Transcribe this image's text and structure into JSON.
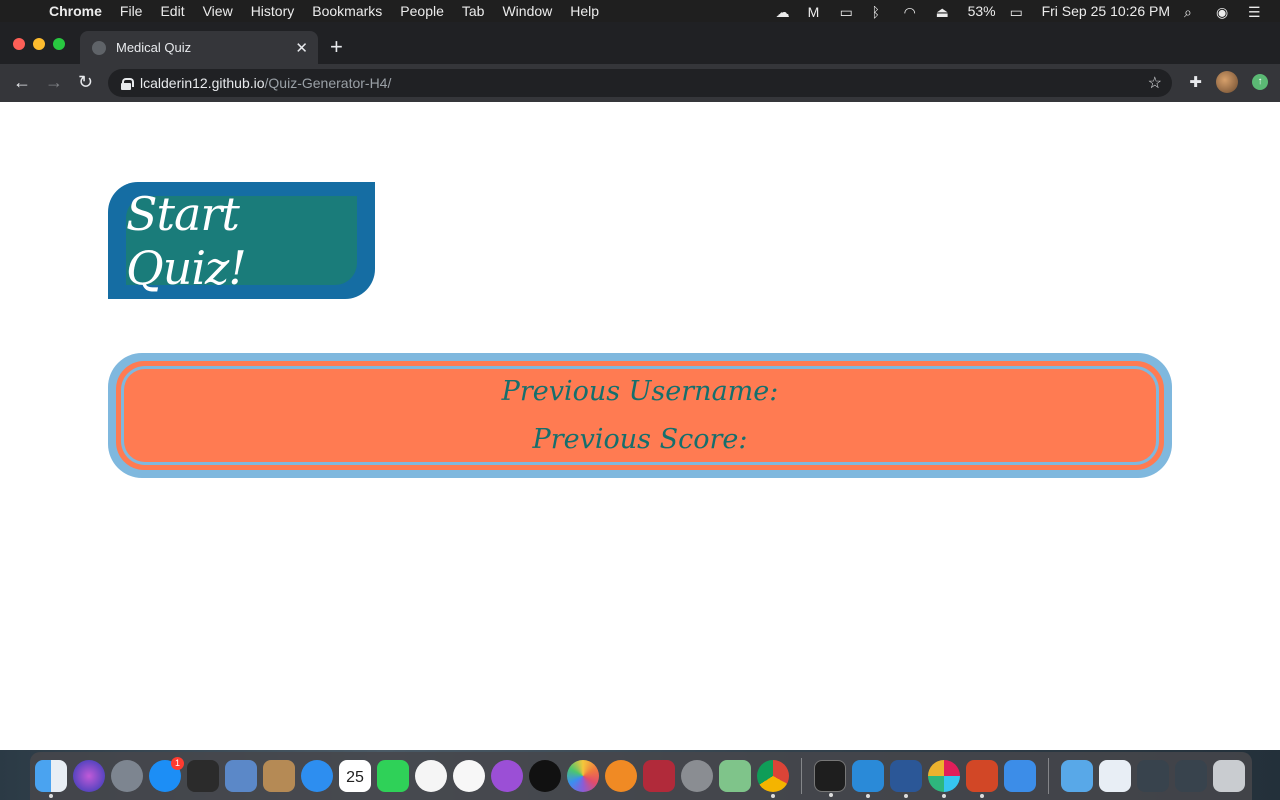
{
  "menubar": {
    "app_name": "Chrome",
    "items": [
      "File",
      "Edit",
      "View",
      "History",
      "Bookmarks",
      "People",
      "Tab",
      "Window",
      "Help"
    ],
    "battery": "53%",
    "clock": "Fri Sep 25  10:26 PM"
  },
  "browser": {
    "tab_title": "Medical Quiz",
    "url_host": "lcalderin12.github.io",
    "url_path": "/Quiz-Generator-H4/"
  },
  "page": {
    "start_button_label": "Start Quiz!",
    "previous_username_label": "Previous Username:",
    "previous_score_label": "Previous Score:"
  },
  "dock": {
    "calendar_day": "25",
    "app_store_badge": "1",
    "icons": [
      "finder-icon",
      "siri-icon",
      "launchpad-icon",
      "app-store-icon",
      "photo-booth-icon",
      "preview-icon",
      "contacts-icon",
      "safari-icon",
      "calendar-icon",
      "facetime-icon",
      "news-icon",
      "music-icon",
      "podcasts-icon",
      "tv-icon",
      "photos-icon",
      "books-icon",
      "photo-booth-2-icon",
      "system-preferences-icon",
      "maps-icon",
      "chrome-icon",
      "terminal-icon",
      "vscode-icon",
      "word-icon",
      "slack-icon",
      "powerpoint-icon",
      "xcode-icon",
      "folder-icon",
      "document-icon",
      "screenshot-1-icon",
      "screenshot-2-icon",
      "trash-icon"
    ]
  },
  "colors": {
    "start_outer": "#156da3",
    "start_inner": "#1a7c7a",
    "score_border": "#7fb8de",
    "score_fill": "#ff7b52",
    "score_text": "#156f6d"
  }
}
